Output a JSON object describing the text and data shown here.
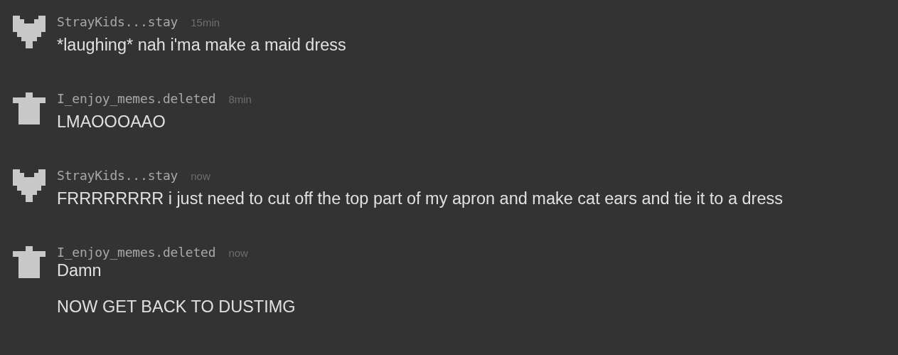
{
  "messages": [
    {
      "kind": "heart",
      "author": "StrayKids...stay",
      "time": "15min",
      "lines": [
        "*laughing* nah i'ma make a maid dress"
      ]
    },
    {
      "kind": "shirt",
      "author": "I_enjoy_memes.deleted",
      "time": "8min",
      "lines": [
        "LMAOOOAAO"
      ]
    },
    {
      "kind": "heart",
      "author": "StrayKids...stay",
      "time": "now",
      "lines": [
        "FRRRRRRRR i just need to cut off the top part of my apron and make cat ears and tie it to a dress"
      ]
    },
    {
      "kind": "shirt",
      "author": "I_enjoy_memes.deleted",
      "time": "now",
      "lines": [
        "Damn",
        "NOW GET BACK TO DUSTIMG"
      ]
    }
  ]
}
